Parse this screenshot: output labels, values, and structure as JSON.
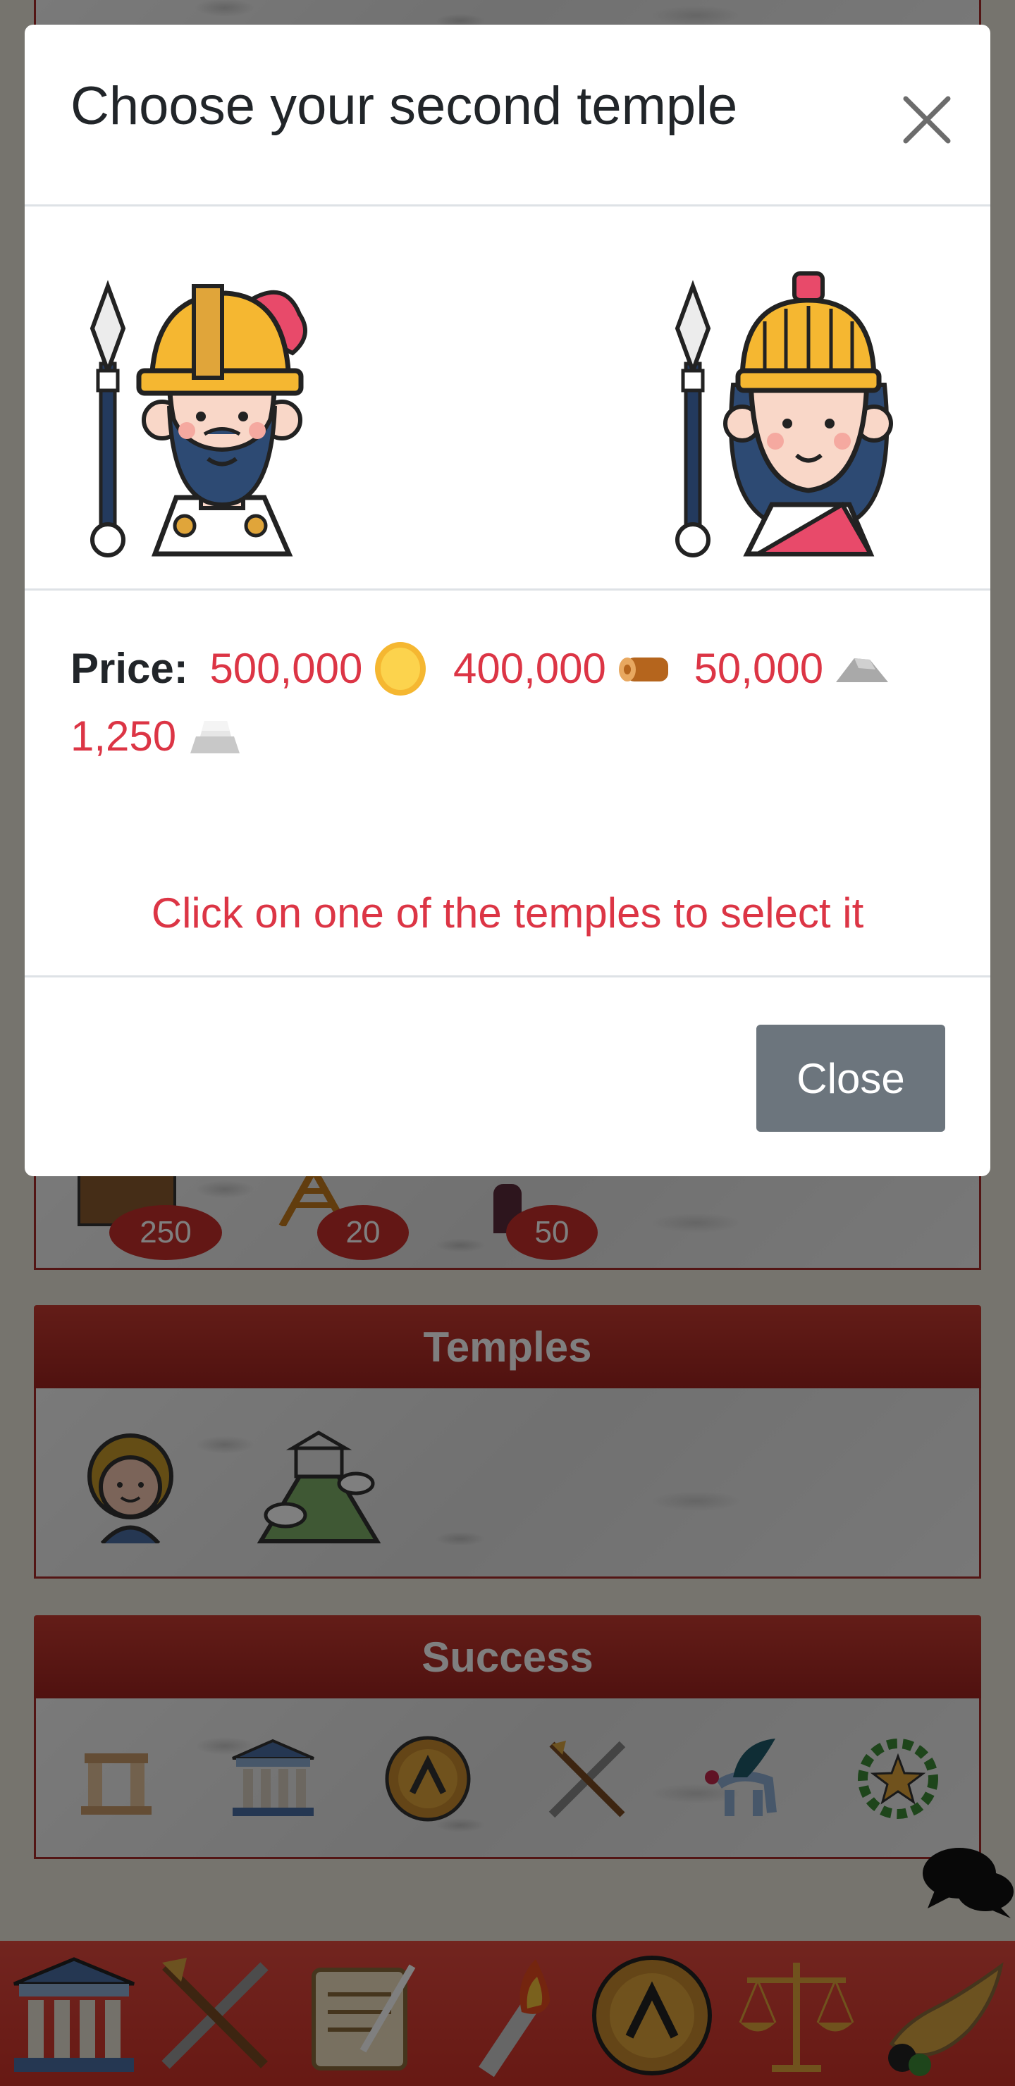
{
  "modal": {
    "title": "Choose your second temple",
    "close_icon": "close-icon",
    "temples": [
      {
        "name": "male-warrior-temple",
        "icon": "spartan-man-icon"
      },
      {
        "name": "female-warrior-temple",
        "icon": "spartan-woman-icon"
      }
    ],
    "price": {
      "label": "Price:",
      "items": [
        {
          "amount": "500,000",
          "icon": "gold-coin-icon"
        },
        {
          "amount": "400,000",
          "icon": "wood-log-icon"
        },
        {
          "amount": "50,000",
          "icon": "stone-icon"
        },
        {
          "amount": "1,250",
          "icon": "silver-ingot-icon"
        }
      ]
    },
    "hint": "Click on one of the temples to select it",
    "close_button": "Close"
  },
  "background": {
    "building_counts": [
      "250",
      "20",
      "50"
    ],
    "temples_section": {
      "title": "Temples",
      "icons": [
        "apollo-head-icon",
        "temple-on-hill-icon"
      ]
    },
    "success_section": {
      "title": "Success",
      "icons": [
        "ruins-icon",
        "temple-icon",
        "spartan-shield-icon",
        "spear-sword-icon",
        "pegasus-icon",
        "laurel-star-icon"
      ]
    },
    "bottom_nav": [
      "temple-icon",
      "crossed-weapons-icon",
      "scroll-quill-icon",
      "torch-icon",
      "shield-icon",
      "scales-icon",
      "cornucopia-icon"
    ],
    "chat_icon": "chat-bubbles-icon"
  },
  "colors": {
    "accent_red": "#dc3545",
    "header_red": "#b8302a",
    "button_gray": "#6c757d"
  }
}
